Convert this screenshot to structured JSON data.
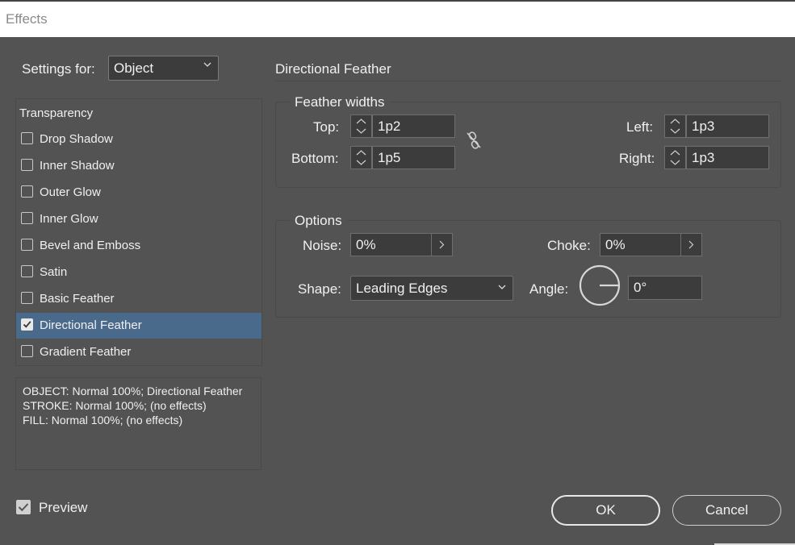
{
  "window": {
    "title": "Effects"
  },
  "settings_for": {
    "label": "Settings for:",
    "value": "Object"
  },
  "effects_list": {
    "header": "Transparency",
    "items": [
      {
        "label": "Drop Shadow",
        "checked": false,
        "selected": false
      },
      {
        "label": "Inner Shadow",
        "checked": false,
        "selected": false
      },
      {
        "label": "Outer Glow",
        "checked": false,
        "selected": false
      },
      {
        "label": "Inner Glow",
        "checked": false,
        "selected": false
      },
      {
        "label": "Bevel and Emboss",
        "checked": false,
        "selected": false
      },
      {
        "label": "Satin",
        "checked": false,
        "selected": false
      },
      {
        "label": "Basic Feather",
        "checked": false,
        "selected": false
      },
      {
        "label": "Directional Feather",
        "checked": true,
        "selected": true
      },
      {
        "label": "Gradient Feather",
        "checked": false,
        "selected": false
      }
    ]
  },
  "summary": {
    "line1": "OBJECT: Normal 100%; Directional Feather",
    "line2": "STROKE: Normal 100%; (no effects)",
    "line3": "FILL: Normal 100%; (no effects)"
  },
  "section_title": "Directional Feather",
  "feather_widths": {
    "title": "Feather widths",
    "top": {
      "label": "Top:",
      "value": "1p2"
    },
    "bottom": {
      "label": "Bottom:",
      "value": "1p5"
    },
    "left": {
      "label": "Left:",
      "value": "1p3"
    },
    "right": {
      "label": "Right:",
      "value": "1p3"
    }
  },
  "options": {
    "title": "Options",
    "noise": {
      "label": "Noise:",
      "value": "0%"
    },
    "choke": {
      "label": "Choke:",
      "value": "0%"
    },
    "shape": {
      "label": "Shape:",
      "value": "Leading Edges"
    },
    "angle": {
      "label": "Angle:",
      "value": "0°"
    }
  },
  "preview": {
    "label": "Preview",
    "checked": true
  },
  "buttons": {
    "ok": "OK",
    "cancel": "Cancel"
  },
  "icons": {
    "link": "unlink-chain-icon",
    "chevron": "chevron-down-icon",
    "angle": "angle-dial-icon"
  }
}
